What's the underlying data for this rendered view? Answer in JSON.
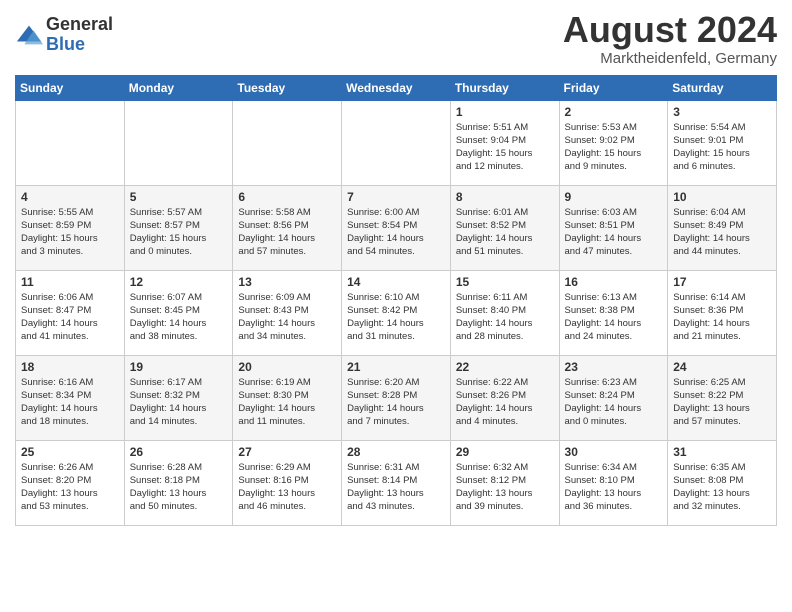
{
  "header": {
    "logo_general": "General",
    "logo_blue": "Blue",
    "month": "August 2024",
    "location": "Marktheidenfeld, Germany"
  },
  "calendar": {
    "days_of_week": [
      "Sunday",
      "Monday",
      "Tuesday",
      "Wednesday",
      "Thursday",
      "Friday",
      "Saturday"
    ],
    "weeks": [
      [
        {
          "day": "",
          "info": ""
        },
        {
          "day": "",
          "info": ""
        },
        {
          "day": "",
          "info": ""
        },
        {
          "day": "",
          "info": ""
        },
        {
          "day": "1",
          "info": "Sunrise: 5:51 AM\nSunset: 9:04 PM\nDaylight: 15 hours\nand 12 minutes."
        },
        {
          "day": "2",
          "info": "Sunrise: 5:53 AM\nSunset: 9:02 PM\nDaylight: 15 hours\nand 9 minutes."
        },
        {
          "day": "3",
          "info": "Sunrise: 5:54 AM\nSunset: 9:01 PM\nDaylight: 15 hours\nand 6 minutes."
        }
      ],
      [
        {
          "day": "4",
          "info": "Sunrise: 5:55 AM\nSunset: 8:59 PM\nDaylight: 15 hours\nand 3 minutes."
        },
        {
          "day": "5",
          "info": "Sunrise: 5:57 AM\nSunset: 8:57 PM\nDaylight: 15 hours\nand 0 minutes."
        },
        {
          "day": "6",
          "info": "Sunrise: 5:58 AM\nSunset: 8:56 PM\nDaylight: 14 hours\nand 57 minutes."
        },
        {
          "day": "7",
          "info": "Sunrise: 6:00 AM\nSunset: 8:54 PM\nDaylight: 14 hours\nand 54 minutes."
        },
        {
          "day": "8",
          "info": "Sunrise: 6:01 AM\nSunset: 8:52 PM\nDaylight: 14 hours\nand 51 minutes."
        },
        {
          "day": "9",
          "info": "Sunrise: 6:03 AM\nSunset: 8:51 PM\nDaylight: 14 hours\nand 47 minutes."
        },
        {
          "day": "10",
          "info": "Sunrise: 6:04 AM\nSunset: 8:49 PM\nDaylight: 14 hours\nand 44 minutes."
        }
      ],
      [
        {
          "day": "11",
          "info": "Sunrise: 6:06 AM\nSunset: 8:47 PM\nDaylight: 14 hours\nand 41 minutes."
        },
        {
          "day": "12",
          "info": "Sunrise: 6:07 AM\nSunset: 8:45 PM\nDaylight: 14 hours\nand 38 minutes."
        },
        {
          "day": "13",
          "info": "Sunrise: 6:09 AM\nSunset: 8:43 PM\nDaylight: 14 hours\nand 34 minutes."
        },
        {
          "day": "14",
          "info": "Sunrise: 6:10 AM\nSunset: 8:42 PM\nDaylight: 14 hours\nand 31 minutes."
        },
        {
          "day": "15",
          "info": "Sunrise: 6:11 AM\nSunset: 8:40 PM\nDaylight: 14 hours\nand 28 minutes."
        },
        {
          "day": "16",
          "info": "Sunrise: 6:13 AM\nSunset: 8:38 PM\nDaylight: 14 hours\nand 24 minutes."
        },
        {
          "day": "17",
          "info": "Sunrise: 6:14 AM\nSunset: 8:36 PM\nDaylight: 14 hours\nand 21 minutes."
        }
      ],
      [
        {
          "day": "18",
          "info": "Sunrise: 6:16 AM\nSunset: 8:34 PM\nDaylight: 14 hours\nand 18 minutes."
        },
        {
          "day": "19",
          "info": "Sunrise: 6:17 AM\nSunset: 8:32 PM\nDaylight: 14 hours\nand 14 minutes."
        },
        {
          "day": "20",
          "info": "Sunrise: 6:19 AM\nSunset: 8:30 PM\nDaylight: 14 hours\nand 11 minutes."
        },
        {
          "day": "21",
          "info": "Sunrise: 6:20 AM\nSunset: 8:28 PM\nDaylight: 14 hours\nand 7 minutes."
        },
        {
          "day": "22",
          "info": "Sunrise: 6:22 AM\nSunset: 8:26 PM\nDaylight: 14 hours\nand 4 minutes."
        },
        {
          "day": "23",
          "info": "Sunrise: 6:23 AM\nSunset: 8:24 PM\nDaylight: 14 hours\nand 0 minutes."
        },
        {
          "day": "24",
          "info": "Sunrise: 6:25 AM\nSunset: 8:22 PM\nDaylight: 13 hours\nand 57 minutes."
        }
      ],
      [
        {
          "day": "25",
          "info": "Sunrise: 6:26 AM\nSunset: 8:20 PM\nDaylight: 13 hours\nand 53 minutes."
        },
        {
          "day": "26",
          "info": "Sunrise: 6:28 AM\nSunset: 8:18 PM\nDaylight: 13 hours\nand 50 minutes."
        },
        {
          "day": "27",
          "info": "Sunrise: 6:29 AM\nSunset: 8:16 PM\nDaylight: 13 hours\nand 46 minutes."
        },
        {
          "day": "28",
          "info": "Sunrise: 6:31 AM\nSunset: 8:14 PM\nDaylight: 13 hours\nand 43 minutes."
        },
        {
          "day": "29",
          "info": "Sunrise: 6:32 AM\nSunset: 8:12 PM\nDaylight: 13 hours\nand 39 minutes."
        },
        {
          "day": "30",
          "info": "Sunrise: 6:34 AM\nSunset: 8:10 PM\nDaylight: 13 hours\nand 36 minutes."
        },
        {
          "day": "31",
          "info": "Sunrise: 6:35 AM\nSunset: 8:08 PM\nDaylight: 13 hours\nand 32 minutes."
        }
      ]
    ]
  }
}
